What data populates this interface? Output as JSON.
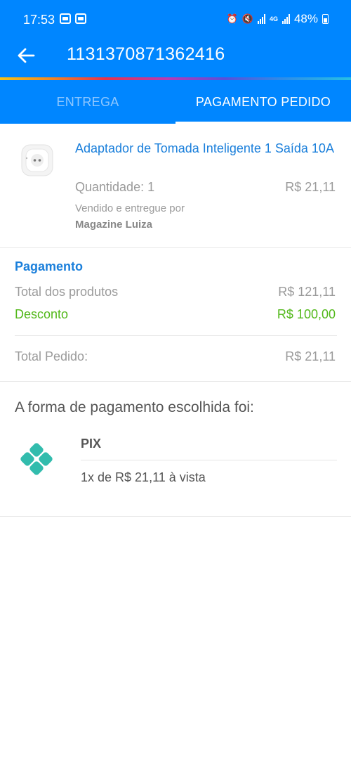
{
  "status_bar": {
    "time": "17:53",
    "network": "4G",
    "battery": "48%"
  },
  "header": {
    "order_number": "1131370871362416",
    "colors": {
      "primary": "#0086ff",
      "accent_blue_text": "#1a7fdb",
      "discount_green": "#52b81a"
    }
  },
  "tabs": [
    {
      "label": "ENTREGA",
      "active": false
    },
    {
      "label": "PAGAMENTO PEDIDO",
      "active": true
    }
  ],
  "product": {
    "name": "Adaptador de Tomada Inteligente 1 Saída 10A",
    "quantity_label": "Quantidade: 1",
    "price": "R$ 21,11",
    "sold_by_label": "Vendido e entregue por",
    "seller": "Magazine Luiza"
  },
  "payment": {
    "heading": "Pagamento",
    "products_total_label": "Total dos produtos",
    "products_total_value": "R$ 121,11",
    "discount_label": "Desconto",
    "discount_value": "R$ 100,00",
    "order_total_label": "Total Pedido:",
    "order_total_value": "R$ 21,11"
  },
  "method": {
    "title": "A forma de pagamento escolhida foi:",
    "name": "PIX",
    "installments": "1x de R$ 21,11 à vista"
  }
}
